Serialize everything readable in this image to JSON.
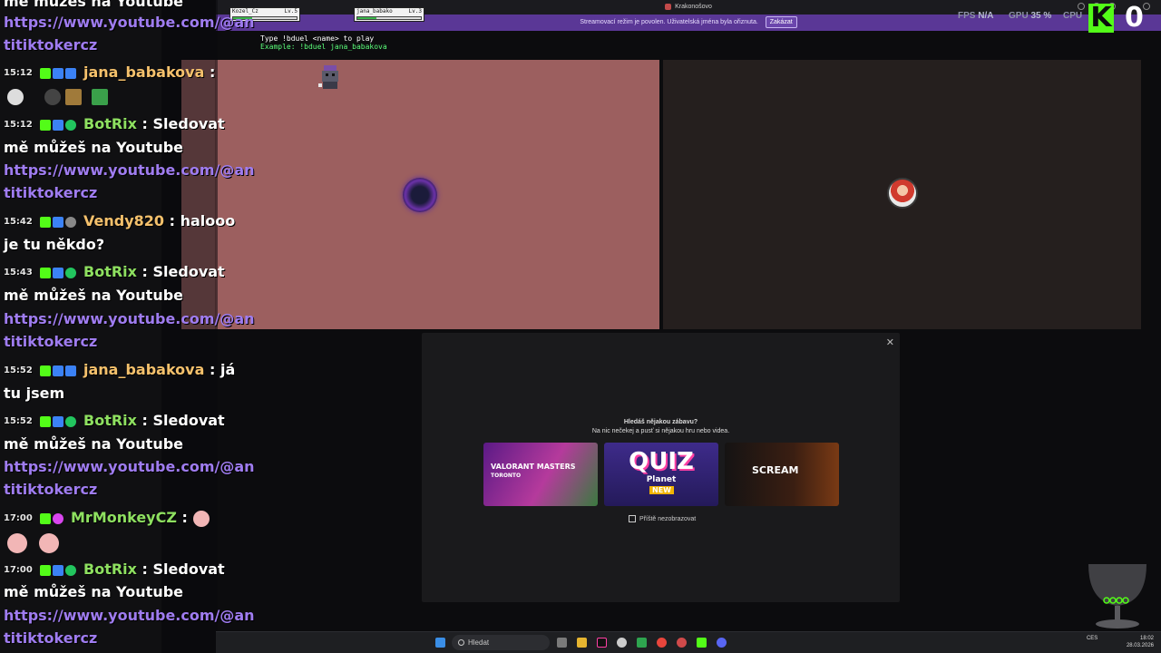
{
  "window": {
    "title": "Krakonošovo"
  },
  "notice": {
    "text": "Streamovací režim je povolen. Uživatelská jména byla ořiznuta.",
    "button": "Zakázat"
  },
  "perf": {
    "fps_label": "FPS",
    "fps_value": "N/A",
    "gpu_label": "GPU",
    "gpu_value": "35 %",
    "cpu_label": "CPU"
  },
  "overlay": {
    "kick_letter": "K",
    "counter": "0"
  },
  "game": {
    "players": [
      {
        "name": "Kozel_Cz",
        "level": "Lv.5",
        "hp": 0.3
      },
      {
        "name": "jana_babako",
        "level": "Lv.3",
        "hp": 0.3
      }
    ],
    "instructions": {
      "line1": "Type !bduel <name> to play",
      "line2": "Example: !bduel jana_babakova"
    }
  },
  "modal": {
    "question": "Hledáš nějakou zábavu?",
    "subtitle": "Na nic nečekej a pusť si nějakou hru nebo videa.",
    "cards": [
      {
        "title": "VALORANT MASTERS",
        "subtitle": "TORONTO"
      },
      {
        "title": "QUIZ",
        "subtitle": "Planet",
        "badge": "NEW"
      },
      {
        "title": "SCREAM"
      }
    ],
    "dont_show": "Příště nezobrazovat"
  },
  "chat": {
    "header": [
      "mě můžeš na Youtube",
      "https://www.youtube.com/@an",
      "titiktokercz"
    ],
    "messages": [
      {
        "time": "15:12",
        "user": "jana_babakova",
        "user_color": "#f5c16c",
        "text": ":"
      },
      {
        "time": "15:12",
        "user": "BotRix",
        "user_color": "#8ee060",
        "text": ": Sledovat"
      },
      {
        "time": "15:42",
        "user": "Vendy820",
        "user_color": "#f5c16c",
        "text": ": halooo"
      },
      {
        "time": "15:43",
        "user": "BotRix",
        "user_color": "#8ee060",
        "text": ": Sledovat"
      },
      {
        "time": "15:52",
        "user": "jana_babakova",
        "user_color": "#f5c16c",
        "text": ": já"
      },
      {
        "time": "15:52",
        "user": "BotRix",
        "user_color": "#8ee060",
        "text": ": Sledovat"
      },
      {
        "time": "17:00",
        "user": "MrMonkeyCZ",
        "user_color": "#8ee060",
        "text": ":"
      },
      {
        "time": "17:00",
        "user": "BotRix",
        "user_color": "#8ee060",
        "text": ": Sledovat"
      }
    ],
    "bot_line2": "mě můžeš na Youtube",
    "bot_line3": "https://www.youtube.com/@an",
    "bot_line4": "titiktokercz",
    "vendy_cont": "je tu někdo?",
    "jana_cont": "tu jsem"
  },
  "taskbar": {
    "search_placeholder": "Hledat",
    "lang": "CES",
    "time": "18:02",
    "date": "28.03.2026"
  }
}
